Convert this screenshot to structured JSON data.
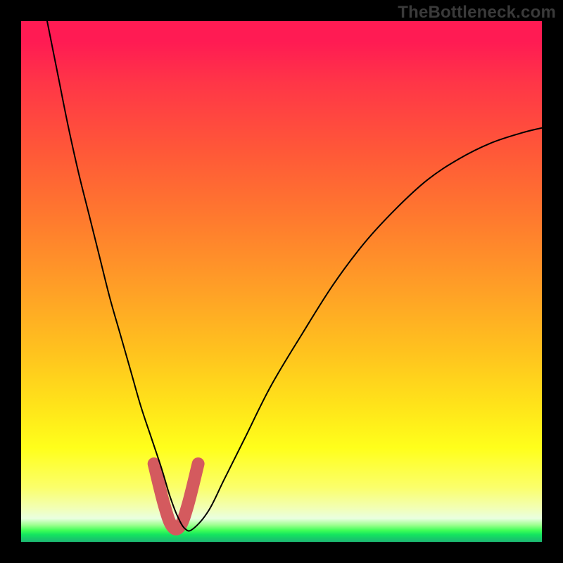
{
  "watermark": "TheBottleneck.com",
  "chart_data": {
    "type": "line",
    "title": "",
    "xlabel": "",
    "ylabel": "",
    "xlim": [
      0,
      100
    ],
    "ylim": [
      0,
      100
    ],
    "legend": false,
    "grid": false,
    "background_gradient": {
      "direction": "vertical",
      "stops": [
        {
          "pos": 0.0,
          "color": "#ff1b53"
        },
        {
          "pos": 0.25,
          "color": "#ff5838"
        },
        {
          "pos": 0.55,
          "color": "#ffb020"
        },
        {
          "pos": 0.8,
          "color": "#ffff1b"
        },
        {
          "pos": 0.95,
          "color": "#e9ffe0"
        },
        {
          "pos": 1.0,
          "color": "#1cb772"
        }
      ]
    },
    "series": [
      {
        "name": "bottleneck-curve",
        "x": [
          5,
          7,
          9,
          11,
          13,
          15,
          17,
          19,
          21,
          23,
          25,
          27,
          28.5,
          30,
          31.5,
          33,
          36,
          39,
          43,
          48,
          54,
          60,
          66,
          72,
          78,
          84,
          90,
          96,
          100
        ],
        "y": [
          100,
          90,
          80,
          71,
          63,
          55,
          47,
          40,
          33,
          26,
          20,
          14,
          9,
          5,
          2.5,
          2.5,
          6,
          12,
          20,
          30,
          40,
          49.5,
          57.5,
          64,
          69.5,
          73.5,
          76.5,
          78.5,
          79.5
        ]
      }
    ],
    "highlight_segment": {
      "name": "optimal-range-marker",
      "color": "#d45a5e",
      "x": [
        25.5,
        27.5,
        29,
        30.5,
        32,
        34
      ],
      "y": [
        15,
        7,
        3,
        3,
        7,
        15
      ]
    }
  }
}
